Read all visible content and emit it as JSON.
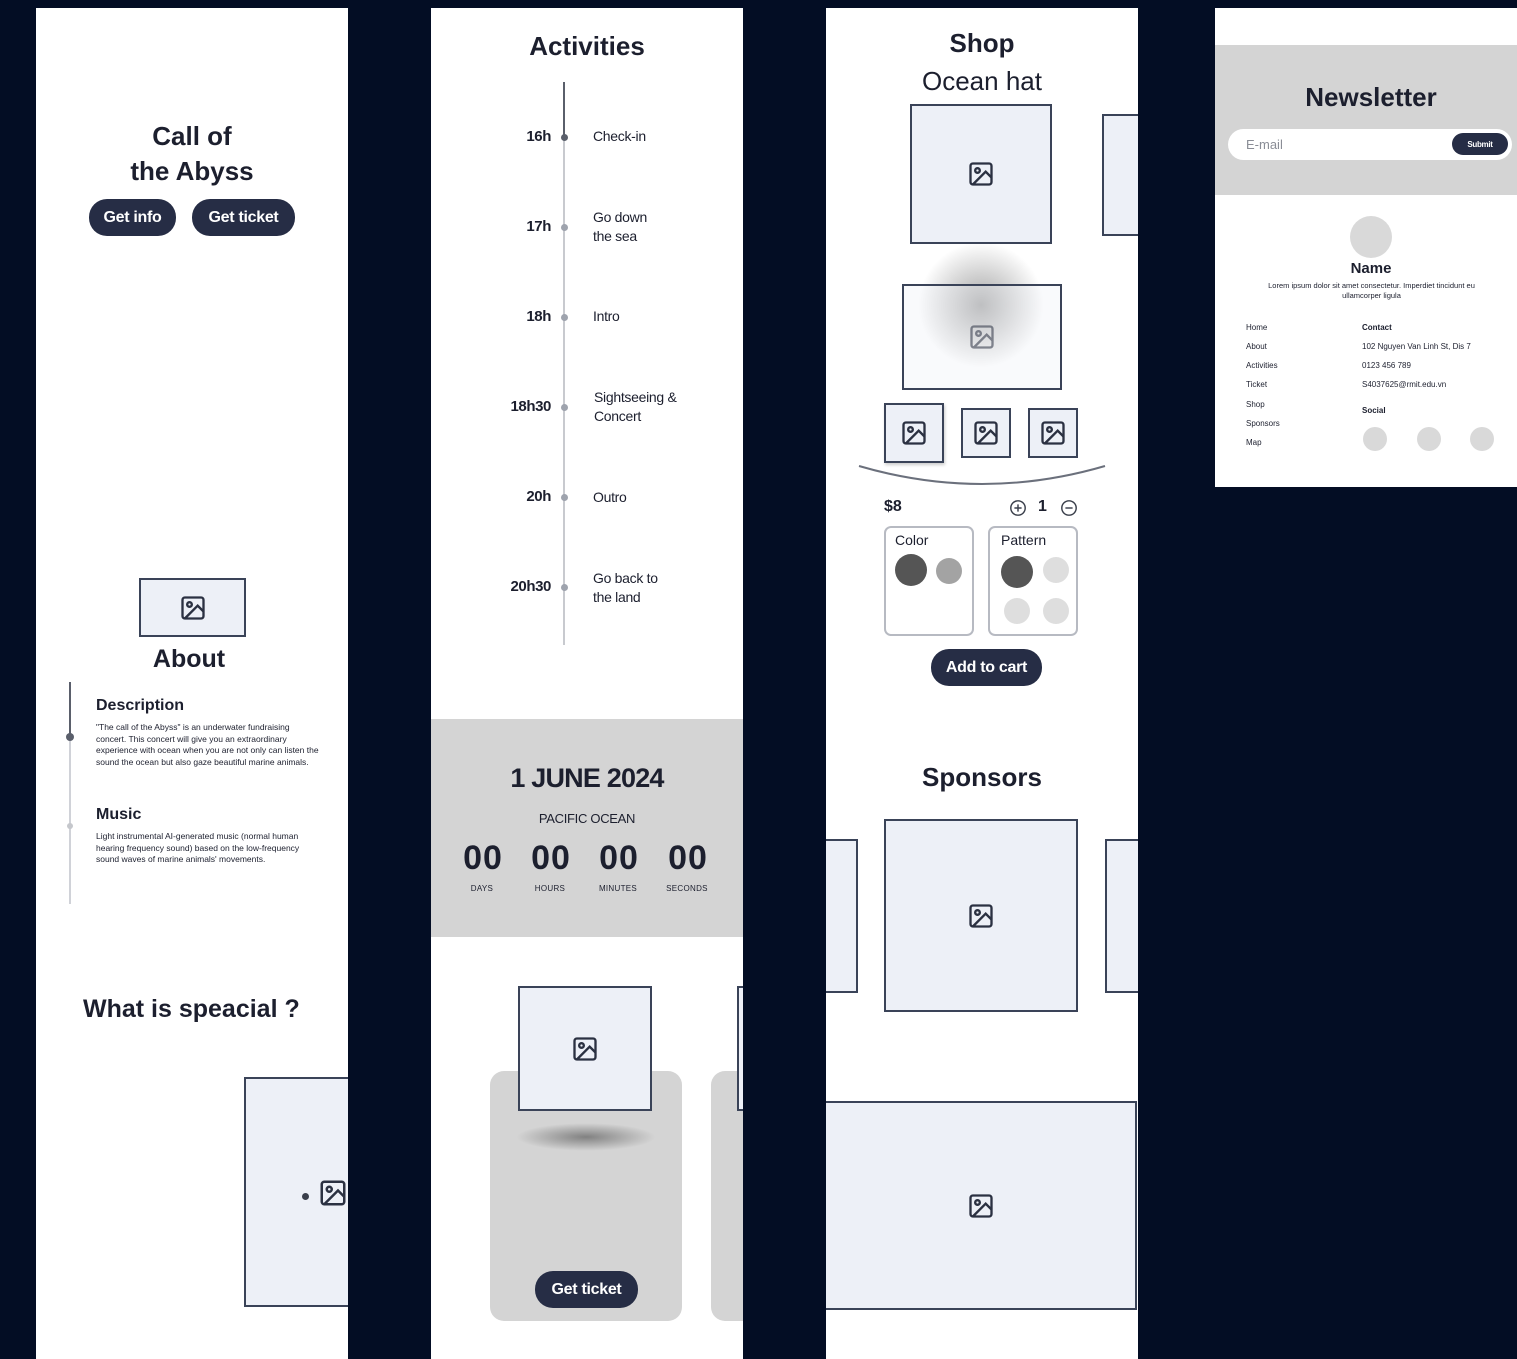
{
  "hero": {
    "title_line1": "Call of",
    "title_line2": "the Abyss",
    "get_info_label": "Get info",
    "get_ticket_label": "Get ticket"
  },
  "about": {
    "heading": "About",
    "description_title": "Description",
    "description_text": "\"The call of the Abyss\" is an underwater fundraising concert. This concert will give you an extraordinary experience with ocean when you are not only can listen the sound the ocean but also gaze beautiful marine animals.",
    "music_title": "Music",
    "music_text": "Light instrumental AI-generated music (normal human hearing frequency sound) based on the low-frequency sound waves of marine animals' movements."
  },
  "special": {
    "heading": "What is speacial ?"
  },
  "activities": {
    "heading": "Activities",
    "items": [
      {
        "time": "16h",
        "label": "Check-in"
      },
      {
        "time": "17h",
        "label": "Go down the sea"
      },
      {
        "time": "18h",
        "label": "Intro"
      },
      {
        "time": "18h30",
        "label": "Sightseeing & Concert"
      },
      {
        "time": "20h",
        "label": "Outro"
      },
      {
        "time": "20h30",
        "label": "Go back to the land"
      }
    ]
  },
  "countdown": {
    "date": "1 JUNE 2024",
    "location": "PACIFIC OCEAN",
    "days": "00",
    "hours": "00",
    "minutes": "00",
    "seconds": "00",
    "days_label": "DAYS",
    "hours_label": "HOURS",
    "minutes_label": "MINUTES",
    "seconds_label": "SECONDS"
  },
  "ticket": {
    "get_ticket_label": "Get ticket"
  },
  "shop": {
    "heading": "Shop",
    "product_name": "Ocean hat",
    "price": "$8",
    "quantity": "1",
    "color_label": "Color",
    "pattern_label": "Pattern",
    "add_to_cart_label": "Add to cart",
    "swatch_dark": "#555555",
    "swatch_mid": "#a3a3a3",
    "swatch_light": "#dedede"
  },
  "sponsors": {
    "heading": "Sponsors"
  },
  "newsletter": {
    "heading": "Newsletter",
    "email_placeholder": "E-mail",
    "submit_label": "Submit"
  },
  "footer": {
    "name": "Name",
    "bio": "Lorem ipsum dolor sit amet consectetur. Imperdiet tincidunt eu ullamcorper ligula",
    "nav": [
      "Home",
      "About",
      "Activities",
      "Ticket",
      "Shop",
      "Sponsors",
      "Map"
    ],
    "contact_heading": "Contact",
    "address": "102 Nguyen Van Linh St, Dis 7",
    "phone": "0123 456 789",
    "email": "S4037625@rmit.edu.vn",
    "social_heading": "Social"
  },
  "colors": {
    "background": "#030d24",
    "button": "#262d45",
    "placeholder_fill": "#edf0f7",
    "grey_band": "#d4d4d4"
  }
}
